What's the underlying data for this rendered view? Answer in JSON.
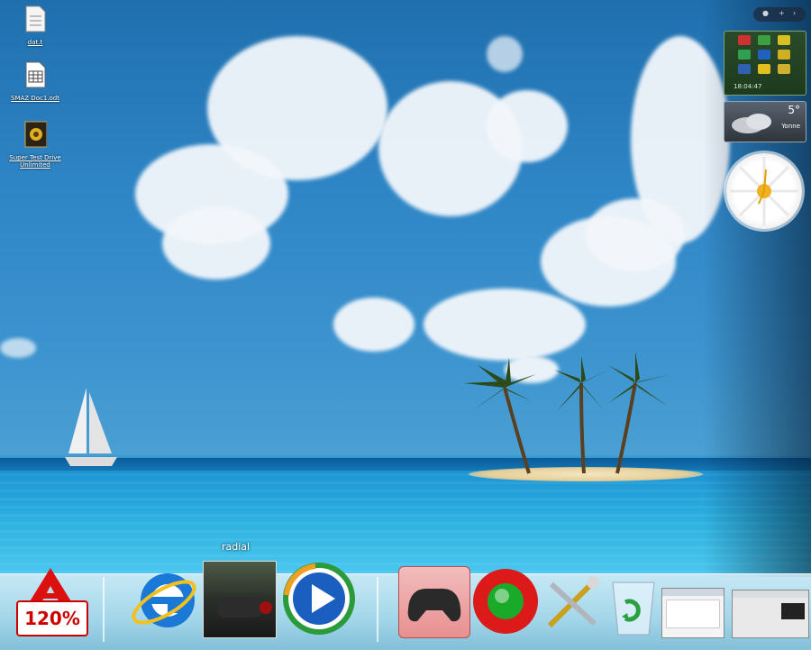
{
  "desktop_icons": [
    {
      "name": "text-file",
      "label": "dat.t"
    },
    {
      "name": "spreadsheet",
      "label": "SMAZ Doc1.odt"
    },
    {
      "name": "game",
      "label": "Super Test Drive Unlimited"
    }
  ],
  "gadgets": {
    "memory_time": "18:04:47",
    "weather_temp": "5°",
    "weather_city": "Yonne"
  },
  "dock": {
    "hover_label": "radial",
    "zoom_label": "120%",
    "items": [
      "zoom",
      "internet-explorer",
      "media-thumbnail",
      "media-player",
      "gamepad",
      "record",
      "tools",
      "recycle-bin",
      "window-preview-1",
      "window-preview-2"
    ]
  },
  "colors": {
    "sky": "#2f86c6",
    "sea": "#2bb0e0",
    "dock": "#cfe9f3",
    "accent_red": "#cc0000"
  }
}
